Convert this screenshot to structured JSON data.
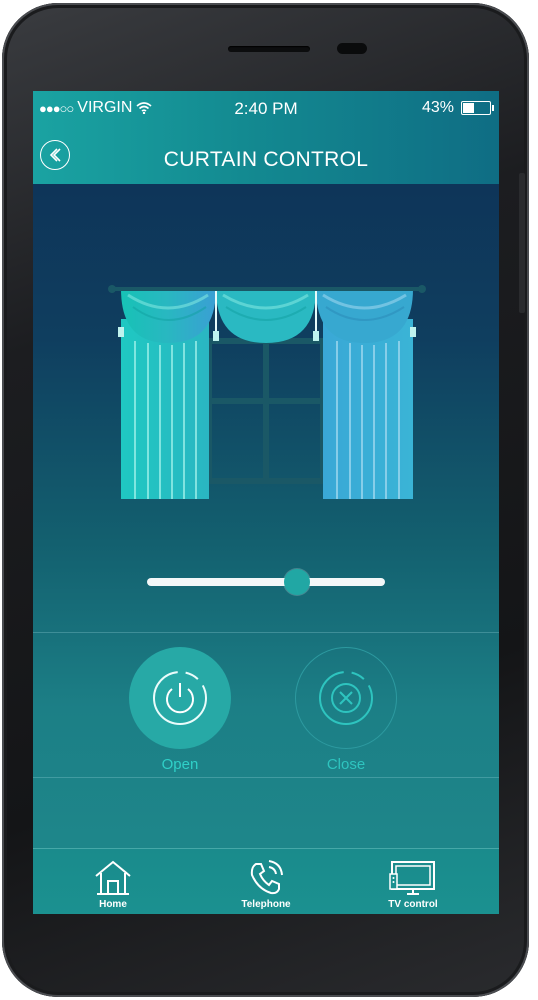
{
  "status_bar": {
    "signal": "●●●○○",
    "carrier": "VIRGIN",
    "time": "2:40 PM",
    "battery": "43%",
    "battery_level": 0.43
  },
  "header": {
    "title": "CURTAIN CONTROL"
  },
  "slider": {
    "position": 0.63
  },
  "controls": {
    "open_label": "Open",
    "close_label": "Close"
  },
  "tabbar": {
    "items": [
      {
        "label": "Home",
        "icon": "home-icon"
      },
      {
        "label": "Telephone",
        "icon": "telephone-icon"
      },
      {
        "label": "TV control",
        "icon": "tv-icon"
      }
    ]
  },
  "colors": {
    "accent": "#27a9a6",
    "header_left": "#1aa3a2",
    "header_right": "#0f6d84",
    "background_top": "#0e2f55",
    "background_bottom": "#1f8a8c"
  }
}
